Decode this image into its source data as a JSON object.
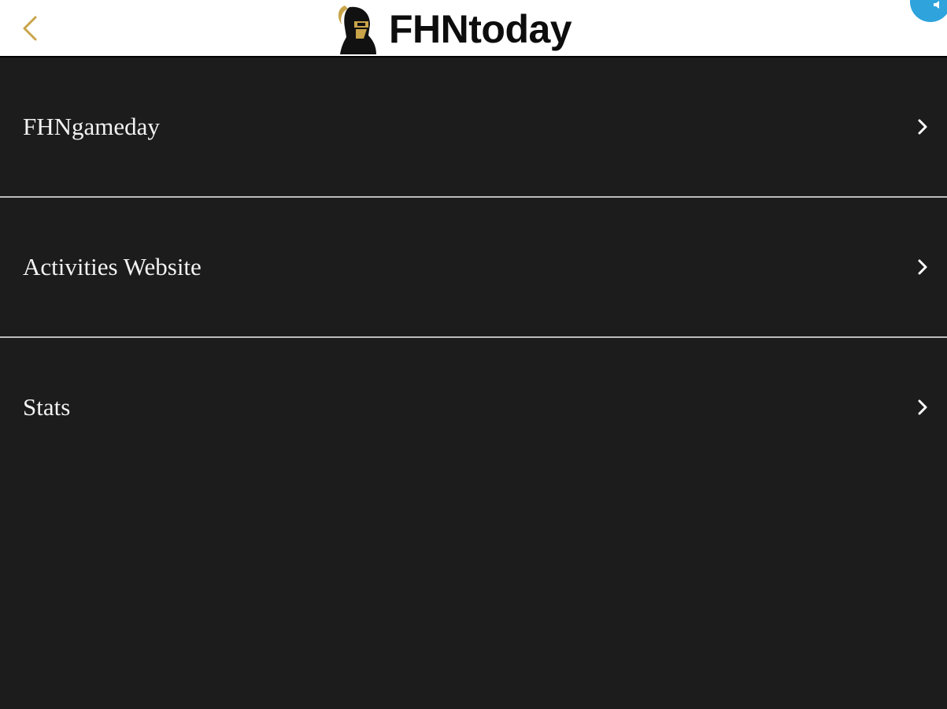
{
  "header": {
    "title": "FHNtoday",
    "back_icon": "chevron-left-icon",
    "logo_icon": "knight-helmet-logo",
    "accent_color": "#c9a449",
    "badge_color": "#2ea3dc",
    "badge_icon": "speaker-icon"
  },
  "menu": {
    "items": [
      {
        "label": "FHNgameday",
        "icon": "chevron-right-icon"
      },
      {
        "label": "Activities Website",
        "icon": "chevron-right-icon"
      },
      {
        "label": "Stats",
        "icon": "chevron-right-icon"
      }
    ]
  },
  "colors": {
    "background": "#1c1c1c",
    "header_background": "#ffffff",
    "divider": "#bdbdbd",
    "text": "#f2f2f2"
  }
}
